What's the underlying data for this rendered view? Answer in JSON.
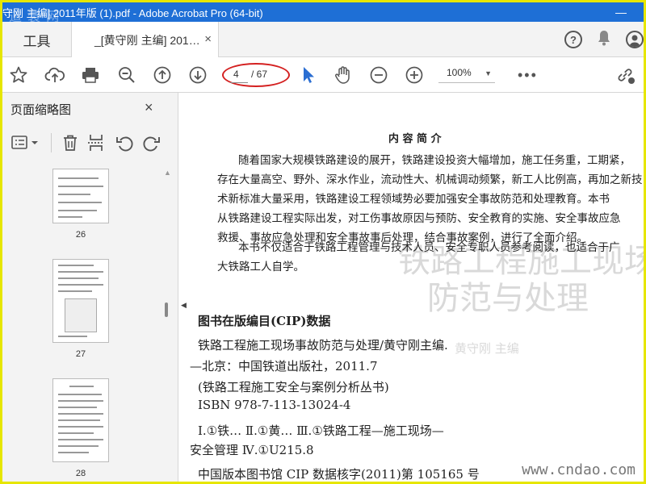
{
  "window": {
    "title": "守刚 主编] 2011年版 (1).pdf - Adobe Acrobat Pro (64-bit)",
    "watermark": "道 装 网",
    "minimize": "—"
  },
  "tabs": {
    "tools_label": "工具",
    "doc_label": "_[黄守刚 主编] 201…",
    "close": "×"
  },
  "toolbar": {
    "page_current": "4",
    "page_total": "/ 67",
    "zoom": "100%",
    "more": "•••"
  },
  "left_panel": {
    "title": "页面缩略图",
    "close": "×",
    "thumbnails": [
      {
        "page": "26"
      },
      {
        "page": "27"
      },
      {
        "page": "28"
      }
    ]
  },
  "document": {
    "heading": "内 容 简 介",
    "para1_lines": [
      "随着国家大规模铁路建设的展开，铁路建设投资大幅增加，施工任务重，工期紧，",
      "存在大量高空、野外、深水作业，流动性大、机械调动频繁，新工人比例高，再加之新技",
      "术新标准大量采用，铁路建设工程领域势必要加强安全事故防范和处理教育。本书",
      "从铁路建设工程实际出发，对工伤事故原因与预防、安全教育的实施、安全事故应急",
      "救援、事故应急处理和安全事故事后处理，结合事故案例，进行了全面介绍。"
    ],
    "para2_lines": [
      "本书不仅适合于铁路工程管理与技术人员、安全专职人员参考阅读，也适合于广",
      "大铁路工人自学。"
    ],
    "cip_heading": "图书在版编目(CIP)数据",
    "cip_lines": [
      "铁路工程施工现场事故防范与处理/黄守刚主编.",
      "—北京：中国铁道出版社，2011.7",
      "(铁路工程施工安全与案例分析丛书)",
      "ISBN 978-7-113-13024-4",
      "Ⅰ.①铁…   Ⅱ.①黄…   Ⅲ.①铁路工程—施工现场—",
      "安全管理   Ⅳ.①U215.8",
      "中国版本图书馆 CIP 数据核字(2011)第 105165 号"
    ],
    "ghost_line1": "铁路工程施工现场事",
    "ghost_line2": "防范与处理",
    "ghost_line3": "黄守刚  主编",
    "site_watermark": "www.cndao.com"
  }
}
